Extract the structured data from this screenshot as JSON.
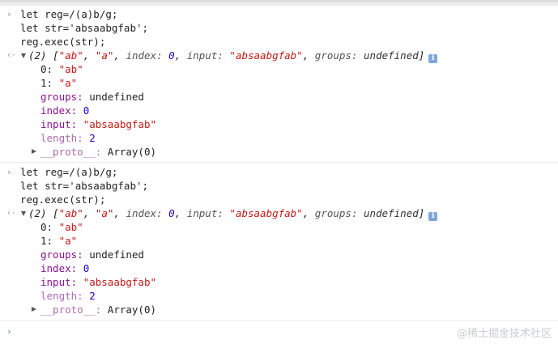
{
  "prompt_symbol": "›",
  "return_symbol": "‹·",
  "entries": [
    {
      "input": [
        "let reg=/(a)b/g;",
        "let str='absaabgfab';",
        "reg.exec(str);"
      ],
      "summary": {
        "count": "(2)",
        "item0": "\"ab\"",
        "item1": "\"a\"",
        "index_key": "index:",
        "index_val": "0",
        "input_key": "input:",
        "input_val": "\"absaabgfab\"",
        "groups_key": "groups:",
        "groups_val": "undefined"
      },
      "props": [
        {
          "key": "0:",
          "value": "\"ab\"",
          "kind": "str",
          "kclass": "idx"
        },
        {
          "key": "1:",
          "value": "\"a\"",
          "kind": "str",
          "kclass": "idx"
        },
        {
          "key": "groups:",
          "value": "undefined",
          "kind": "plain",
          "kclass": "named"
        },
        {
          "key": "index:",
          "value": "0",
          "kind": "num",
          "kclass": "named"
        },
        {
          "key": "input:",
          "value": "\"absaabgfab\"",
          "kind": "str",
          "kclass": "named"
        },
        {
          "key": "length:",
          "value": "2",
          "kind": "num",
          "kclass": "dim"
        }
      ],
      "proto_key": "__proto__:",
      "proto_val": "Array(0)"
    },
    {
      "input": [
        "let reg=/(a)b/g;",
        "let str='absaabgfab';",
        "reg.exec(str);"
      ],
      "summary": {
        "count": "(2)",
        "item0": "\"ab\"",
        "item1": "\"a\"",
        "index_key": "index:",
        "index_val": "0",
        "input_key": "input:",
        "input_val": "\"absaabgfab\"",
        "groups_key": "groups:",
        "groups_val": "undefined"
      },
      "props": [
        {
          "key": "0:",
          "value": "\"ab\"",
          "kind": "str",
          "kclass": "idx"
        },
        {
          "key": "1:",
          "value": "\"a\"",
          "kind": "str",
          "kclass": "idx"
        },
        {
          "key": "groups:",
          "value": "undefined",
          "kind": "plain",
          "kclass": "named"
        },
        {
          "key": "index:",
          "value": "0",
          "kind": "num",
          "kclass": "named"
        },
        {
          "key": "input:",
          "value": "\"absaabgfab\"",
          "kind": "str",
          "kclass": "named"
        },
        {
          "key": "length:",
          "value": "2",
          "kind": "num",
          "kclass": "dim"
        }
      ],
      "proto_key": "__proto__:",
      "proto_val": "Array(0)"
    }
  ],
  "info_icon_label": "i",
  "watermark": "@稀土掘金技术社区"
}
